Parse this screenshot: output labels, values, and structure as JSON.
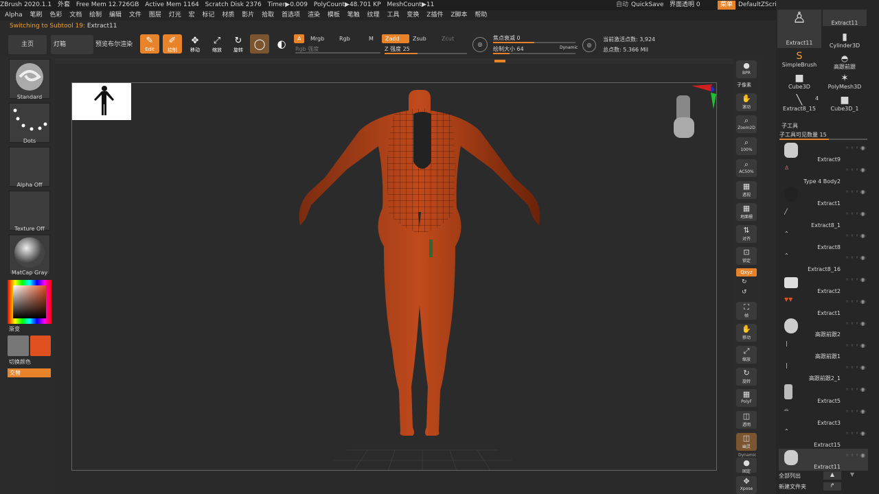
{
  "titlebar": {
    "app": "ZBrush 2020.1.1",
    "extra": "外套",
    "free_mem": "Free Mem 12.726GB",
    "active_mem": "Active Mem 1164",
    "scratch": "Scratch Disk 2376",
    "timer": "Timer▶0.009",
    "polycount": "PolyCount▶48.701 KP",
    "meshcount": "MeshCount▶11",
    "auto": "自动",
    "quicksave": "QuickSave",
    "transparency": "界面透明 0",
    "menu": "菜单",
    "script": "DefaultZScript"
  },
  "menubar": [
    "Alpha",
    "笔刷",
    "色彩",
    "文档",
    "绘制",
    "编辑",
    "文件",
    "图层",
    "灯光",
    "宏",
    "标记",
    "材质",
    "影片",
    "拾取",
    "首选项",
    "渲染",
    "模板",
    "笔触",
    "纹理",
    "工具",
    "变换",
    "Z插件",
    "Z脚本",
    "帮助"
  ],
  "notice": {
    "prefix": "Switching to Subtool 19:",
    "name": "Extract11"
  },
  "tabs": {
    "home": "主页",
    "lightbox": "灯箱",
    "preview": "预览布尔渲染"
  },
  "tools": {
    "edit": "Edit",
    "draw": "绘制",
    "move": "移动",
    "scale": "缩放",
    "rotate": "旋转"
  },
  "modes": {
    "a": "A",
    "mrgb": "Mrgb",
    "rgb": "Rgb",
    "m": "M",
    "zadd": "Zadd",
    "zsub": "Zsub",
    "zcut": "Zcut",
    "rgb_intensity": "Rgb 强度",
    "z_intensity": "Z 强度 25",
    "focal": "焦点衰减 0",
    "draw_size": "绘制大小 64",
    "dynamic": "Dynamic",
    "active_points": "当前激活点数: 3,924",
    "total_points": "总点数: 5.366 Mil"
  },
  "left": {
    "brush": "Standard",
    "stroke": "Dots",
    "alpha": "Alpha Off",
    "texture": "Texture Off",
    "material": "MatCap Gray",
    "gradient": "渐变",
    "switch_color": "切换颜色",
    "alternate": "交替",
    "main_color": "#e05020",
    "secondary_color": "#777777"
  },
  "shelf": [
    "BPR",
    "子像素",
    "滚动",
    "Zoom2D",
    "100%",
    "AC50%",
    "透视",
    "地面栅",
    "对齐",
    "锁定",
    "Qxyz",
    "",
    "",
    "帧",
    "移动",
    "缩放",
    "旋转",
    "PolyF",
    "透明",
    "幽灵",
    "Dynamic",
    "固定",
    "Xpose"
  ],
  "tool_thumbs": [
    "Extract11",
    "Cylinder3D",
    "SimpleBrush",
    "高跟前跟",
    "Cube3D",
    "PolyMesh3D",
    "Extract8_15",
    "Cube3D_1"
  ],
  "tool_count": "4",
  "subtool": {
    "header": "子工具",
    "visible": "子工具可见数量 15",
    "items": [
      "Extract9",
      "Type 4 Body2",
      "Extract1",
      "Extract8_1",
      "Extract8",
      "Extract8_16",
      "Extract2",
      "Extract1",
      "高跟前跟2",
      "高跟前跟1",
      "高跟前跟2_1",
      "Extract5",
      "Extract3",
      "Extract15",
      "Extract11"
    ],
    "list_all": "全部列出",
    "new_folder": "新建文件夹"
  }
}
